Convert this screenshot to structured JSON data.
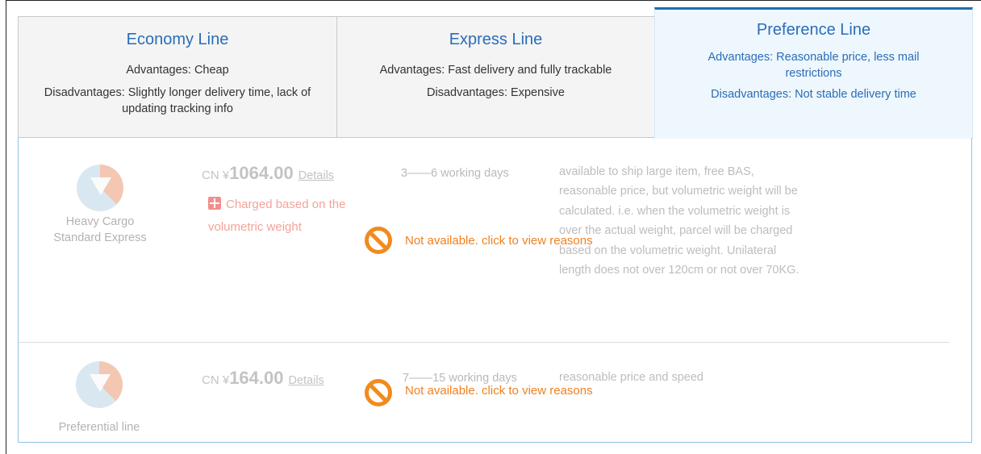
{
  "tabs": [
    {
      "title": "Economy Line",
      "advantages": "Advantages: Cheap",
      "disadvantages": "Disadvantages: Slightly longer delivery time, lack of updating tracking info",
      "active": false
    },
    {
      "title": "Express Line",
      "advantages": "Advantages: Fast delivery and fully trackable",
      "disadvantages": "Disadvantages: Expensive",
      "active": false
    },
    {
      "title": "Preference Line",
      "advantages": "Advantages: Reasonable price, less mail restrictions",
      "disadvantages": "Disadvantages: Not stable delivery time",
      "active": true
    }
  ],
  "services": [
    {
      "name_line1": "Heavy Cargo",
      "name_line2": "Standard Express",
      "currency": "CN ¥",
      "price": "1064.00",
      "details_label": "Details",
      "charge_line1": "Charged based on the",
      "charge_line2": "volumetric weight",
      "delivery": "3——6 working days",
      "description": "available to ship large item, free BAS, reasonable price, but volumetric weight will be calculated. i.e. when the volumetric weight is over the actual weight, parcel will be charged based on the volumetric weight. Unilateral length does not over 120cm or not over 70KG.",
      "unavailable_text": "Not available. click to view reasons"
    },
    {
      "name_line1": "Preferential line",
      "currency": "CN ¥",
      "price": "164.00",
      "details_label": "Details",
      "delivery": "7——15 working days",
      "description": "reasonable price and speed",
      "unavailable_text": "Not available. click to view reasons"
    }
  ],
  "colors": {
    "tab_title": "#2a6db8",
    "active_tab_bg": "#eef7fd",
    "active_tab_border": "#1a6fb4",
    "panel_border": "#8fc4e6",
    "unavailable": "#f0801e",
    "charge_note": "#f4a39a"
  },
  "icons": {
    "service_logo": "service-logo-icon",
    "charge": "calculator-icon",
    "unavailable": "prohibited-icon"
  }
}
